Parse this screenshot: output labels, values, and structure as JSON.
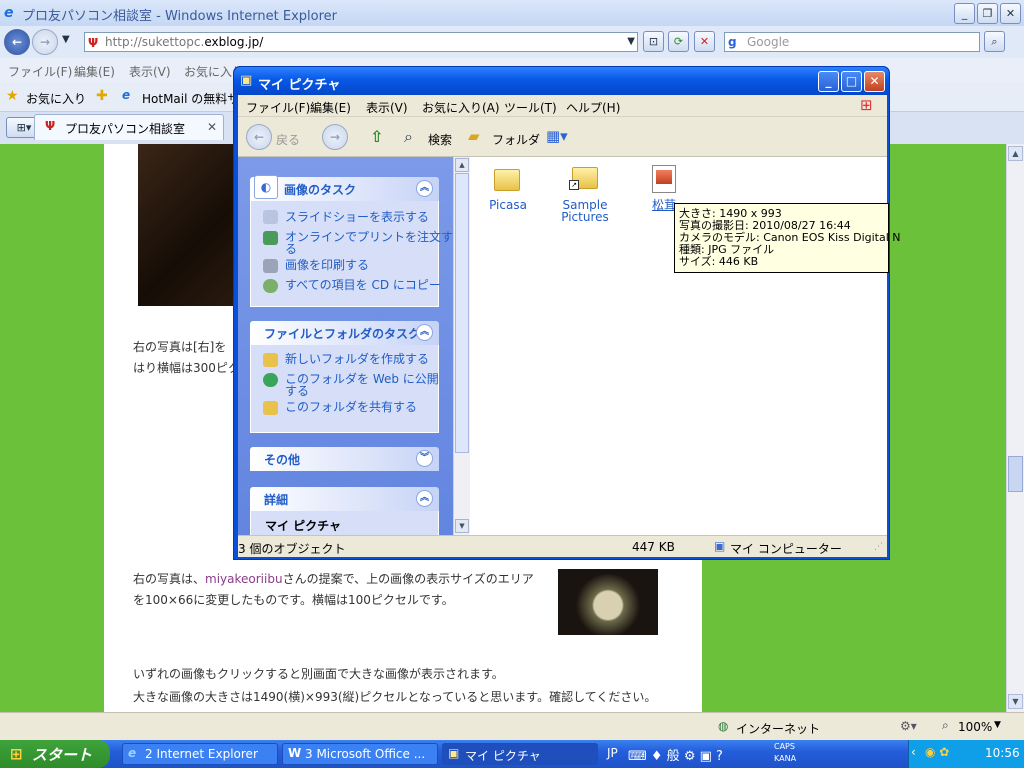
{
  "ie": {
    "title": "プロ友パソコン相談室 - Windows Internet Explorer",
    "address_prefix": "http://sukettopc.",
    "address_domain": "exblog.jp/",
    "search_placeholder": "Google",
    "menu": [
      "ファイル(F)",
      "編集(E)",
      "表示(V)",
      "お気に入り"
    ],
    "favorites_label": "お気に入り",
    "fav_link": "HotMail の無料サー",
    "tab_title": "プロ友パソコン相談室",
    "status_zone": "インターネット",
    "zoom": "100%"
  },
  "page": {
    "text1_line1": "右の写真は[右]を",
    "text1_line2": "はり横幅は300ピク",
    "text2_line1_a": "右の写真は、",
    "text2_link": "miyakeoriibu",
    "text2_line1_b": "さんの提案で、上の画像の表示サイズのエリア",
    "text2_line2": "を100×66に変更したものです。横幅は100ピクセルです。",
    "text3_line1": "いずれの画像もクリックすると別画面で大きな画像が表示されます。",
    "text3_line2": "大きな画像の大きさは1490(横)×993(縦)ピクセルとなっていると思います。確認してください。"
  },
  "explorer": {
    "title": "マイ ピクチャ",
    "menu": [
      "ファイル(F)",
      "編集(E)",
      "表示(V)",
      "お気に入り(A)",
      "ツール(T)",
      "ヘルプ(H)"
    ],
    "toolbar": {
      "back": "戻る",
      "search": "検索",
      "folders": "フォルダ"
    },
    "panels": {
      "image_tasks": {
        "title": "画像のタスク",
        "links": [
          "スライドショーを表示する",
          "オンラインでプリントを注文す",
          "る",
          "画像を印刷する",
          "すべての項目を CD にコピー"
        ]
      },
      "file_tasks": {
        "title": "ファイルとフォルダのタスク",
        "links": [
          "新しいフォルダを作成する",
          "このフォルダを Web に公開",
          "する",
          "このフォルダを共有する"
        ]
      },
      "other": {
        "title": "その他"
      },
      "details": {
        "title": "詳細",
        "name": "マイ ピクチャ"
      }
    },
    "items": [
      {
        "label": "Picasa"
      },
      {
        "label": "Sample",
        "label2": "Pictures"
      },
      {
        "label": "松茸"
      }
    ],
    "tooltip": [
      "大きさ: 1490 x 993",
      "写真の撮影日: 2010/08/27 16:44",
      "カメラのモデル: Canon EOS Kiss Digital N",
      "種類: JPG ファイル",
      "サイズ: 446 KB"
    ],
    "status": {
      "objects": "3 個のオブジェクト",
      "size": "447 KB",
      "location": "マイ コンピューター"
    }
  },
  "taskbar": {
    "start": "スタート",
    "tasks": [
      "2 Internet Explorer",
      "3 Microsoft Office ...",
      "マイ ピクチャ"
    ],
    "lang": "JP",
    "caps": "CAPS",
    "kana": "KANA",
    "clock": "10:56"
  }
}
